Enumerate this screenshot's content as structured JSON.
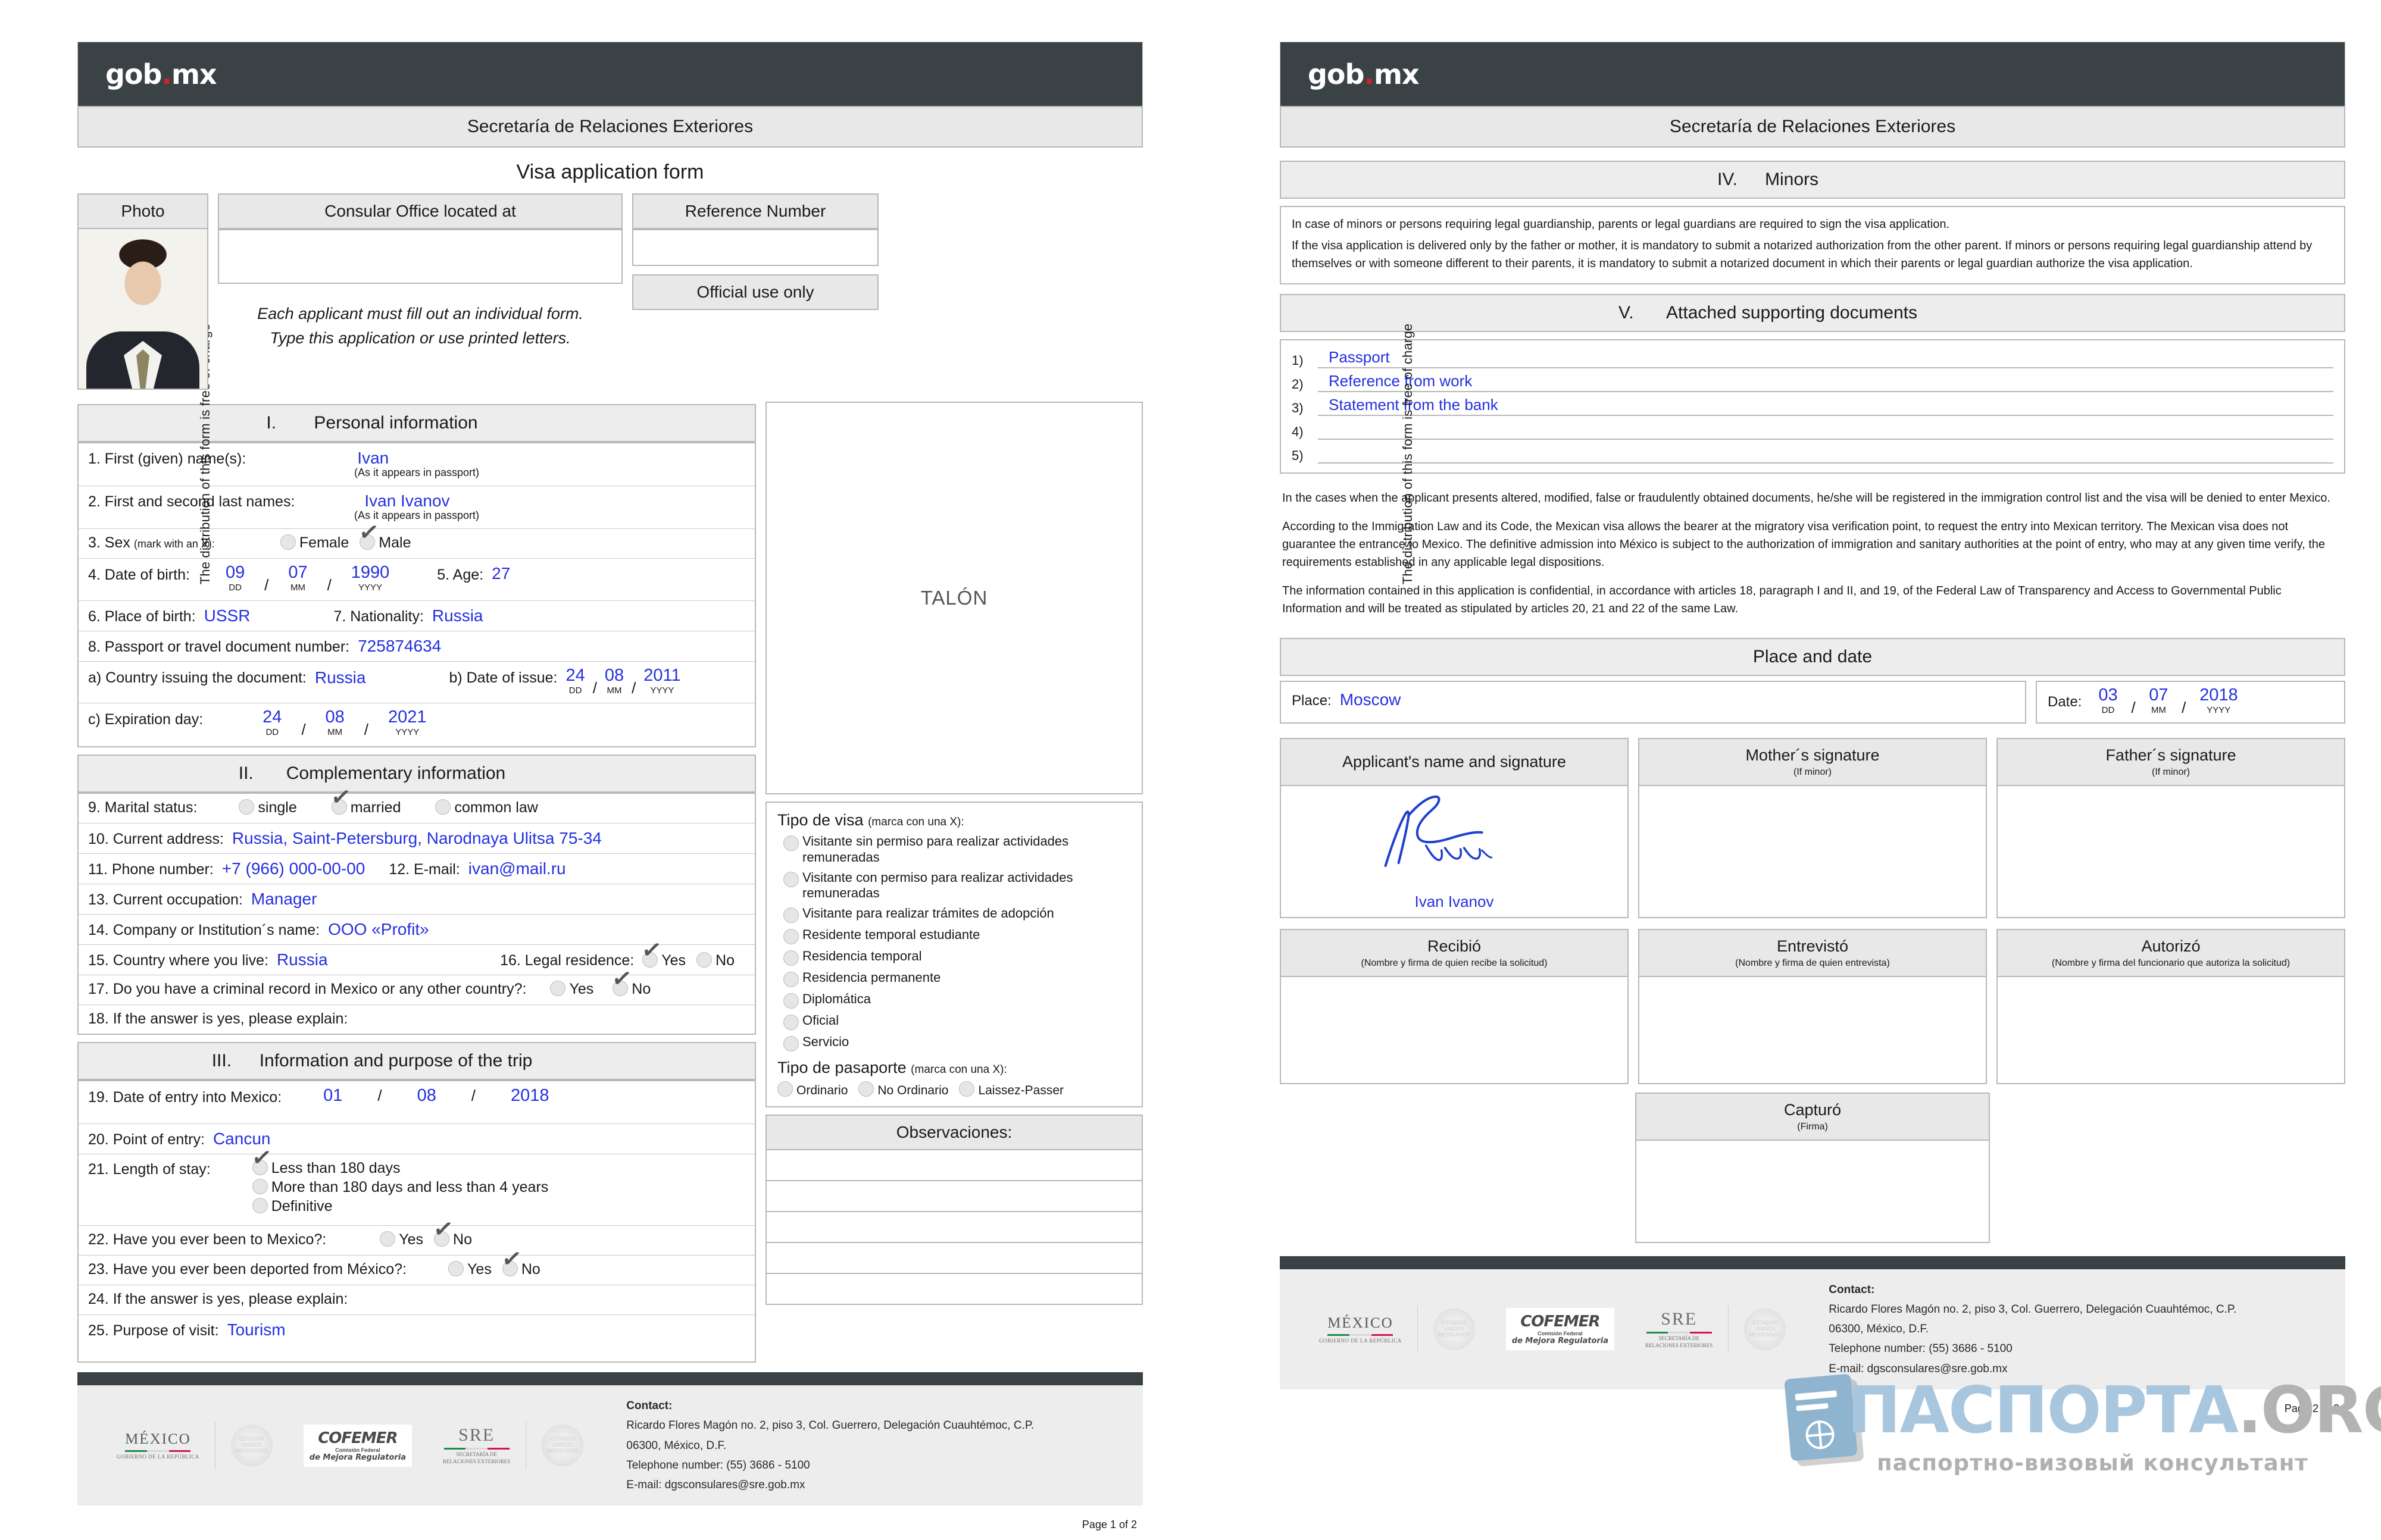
{
  "brand": {
    "logo_text": "gob",
    "logo_dot": ".",
    "logo_suffix": "mx",
    "accent_red": "#d62027",
    "value_blue": "#2430e0"
  },
  "side_note": "The distribution of this form is free of charge",
  "header": {
    "ministry": "Secretaría de Relaciones Exteriores",
    "form_title": "Visa application form"
  },
  "page1": {
    "photo_label": "Photo",
    "consular_office_label": "Consular Office located at",
    "consular_office_value": "",
    "instructions_line1": "Each applicant must fill out an individual form.",
    "instructions_line2": "Type this application or use printed letters.",
    "reference_number_label": "Reference Number",
    "reference_number_value": "",
    "official_use_label": "Official use only",
    "talon_label": "TALÓN",
    "section1": {
      "numeral": "I.",
      "title": "Personal information",
      "q1_label": "1. First (given) name(s):",
      "q1_value": "Ivan",
      "q1_hint": "(As it appears in passport)",
      "q2_label": "2. First and second last names:",
      "q2_value": "Ivan Ivanov",
      "q2_hint": "(As it appears in passport)",
      "q3_label": "3. Sex",
      "q3_hint": "(mark with an X):",
      "q3_options": [
        "Female",
        "Male"
      ],
      "q3_selected": "Male",
      "q4_label": "4. Date of birth:",
      "q4_dd": "09",
      "q4_mm": "07",
      "q4_yyyy": "1990",
      "q5_label": "5. Age:",
      "q5_value": "27",
      "q6_label": "6. Place of birth:",
      "q6_value": "USSR",
      "q7_label": "7. Nationality:",
      "q7_value": "Russia",
      "q8_label": "8. Passport or travel document number:",
      "q8_value": "725874634",
      "qa_label": "a) Country issuing the document:",
      "qa_value": "Russia",
      "qb_label": "b) Date of issue:",
      "qb_dd": "24",
      "qb_mm": "08",
      "qb_yyyy": "2011",
      "qc_label": "c) Expiration day:",
      "qc_dd": "24",
      "qc_mm": "08",
      "qc_yyyy": "2021",
      "unit_dd": "DD",
      "unit_mm": "MM",
      "unit_yyyy": "YYYY"
    },
    "section2": {
      "numeral": "II.",
      "title": "Complementary information",
      "q9_label": "9. Marital status:",
      "q9_options": [
        "single",
        "married",
        "common law"
      ],
      "q9_selected": "married",
      "q10_label": "10. Current address:",
      "q10_value": "Russia, Saint-Petersburg, Narodnaya Ulitsa 75-34",
      "q11_label": "11. Phone number:",
      "q11_value": "+7 (966) 000-00-00",
      "q12_label": "12. E-mail:",
      "q12_value": "ivan@mail.ru",
      "q13_label": "13. Current occupation:",
      "q13_value": "Manager",
      "q14_label": "14. Company or Institution´s name:",
      "q14_value": "OOO «Profit»",
      "q15_label": "15. Country where you live:",
      "q15_value": "Russia",
      "q16_label": "16. Legal residence:",
      "q16_options": [
        "Yes",
        "No"
      ],
      "q16_selected": "Yes",
      "q17_label": "17. Do you have a criminal record in Mexico or any other country?:",
      "q17_options": [
        "Yes",
        "No"
      ],
      "q17_selected": "No",
      "q18_label": "18. If the answer is yes, please explain:",
      "q18_value": ""
    },
    "section3": {
      "numeral": "III.",
      "title": "Information and purpose of the trip",
      "q19_label": "19. Date of entry into Mexico:",
      "q19_dd": "01",
      "q19_mm": "08",
      "q19_yyyy": "2018",
      "q20_label": "20. Point of entry:",
      "q20_value": "Cancun",
      "q21_label": "21. Length of stay:",
      "q21_options": [
        "Less than 180 days",
        "More than 180 days and less than 4 years",
        "Definitive"
      ],
      "q21_selected": "Less than 180 days",
      "q22_label": "22. Have you ever been to Mexico?:",
      "q22_options": [
        "Yes",
        "No"
      ],
      "q22_selected": "No",
      "q23_label": "23. Have you ever been deported from México?:",
      "q23_options": [
        "Yes",
        "No"
      ],
      "q23_selected": "No",
      "q24_label": "24. If the answer is yes, please explain:",
      "q24_value": "",
      "q25_label": "25. Purpose of visit:",
      "q25_value": "Tourism"
    },
    "visa_type": {
      "title": "Tipo de visa",
      "hint": "(marca con una X):",
      "options": [
        "Visitante sin permiso para realizar actividades remuneradas",
        "Visitante con permiso para realizar actividades remuneradas",
        "Visitante para realizar trámites de adopción",
        "Residente temporal estudiante",
        "Residencia temporal",
        "Residencia permanente",
        "Diplomática",
        "Oficial",
        "Servicio"
      ],
      "selected": ""
    },
    "passport_type": {
      "title": "Tipo de pasaporte",
      "hint": "(marca con una X):",
      "options": [
        "Ordinario",
        "No Ordinario",
        "Laissez-Passer"
      ],
      "selected": ""
    },
    "observaciones_label": "Observaciones:",
    "page_number": "Page 1 of 2"
  },
  "page2": {
    "section4": {
      "numeral": "IV.",
      "title": "Minors",
      "p1": "In case of minors or persons requiring legal guardianship, parents or legal guardians are required to sign the visa application.",
      "p2": "If the visa application is delivered only by the father or mother, it is mandatory to submit a notarized authorization from the other parent. If minors or persons requiring legal guardianship attend by themselves or with someone different to their parents, it is mandatory to submit a notarized document in which their parents or legal guardian authorize the visa application."
    },
    "section5": {
      "numeral": "V.",
      "title": "Attached supporting documents",
      "items": [
        {
          "n": "1)",
          "value": "Passport"
        },
        {
          "n": "2)",
          "value": "Reference from work"
        },
        {
          "n": "3)",
          "value": "Statement from the bank"
        },
        {
          "n": "4)",
          "value": ""
        },
        {
          "n": "5)",
          "value": ""
        }
      ]
    },
    "legal": {
      "p1": "In the cases when the applicant presents altered, modified, false or fraudulently obtained documents, he/she will be registered in the immigration control list and the visa will be denied to enter Mexico.",
      "p2": "According to the Immigration Law and its Code, the Mexican visa allows the bearer at the migratory visa verification point, to request the entry into Mexican territory. The Mexican visa does not guarantee the entrance to Mexico. The definitive admission into México is subject to the authorization of immigration and sanitary authorities at the point of entry, who may at any given time verify, the requirements established in any applicable legal dispositions.",
      "p3": "The information contained in this application is confidential, in accordance with articles 18, paragraph I and II, and 19, of the Federal Law of Transparency and Access to Governmental Public Information and will be treated as stipulated by articles 20, 21 and 22 of the same Law."
    },
    "place_and_date": {
      "title": "Place and date",
      "place_label": "Place:",
      "place_value": "Moscow",
      "date_label": "Date:",
      "dd": "03",
      "mm": "07",
      "yyyy": "2018",
      "unit_dd": "DD",
      "unit_mm": "MM",
      "unit_yyyy": "YYYY"
    },
    "signatures": {
      "applicant_title": "Applicant's name and signature",
      "applicant_name": "Ivan Ivanov",
      "mother_title": "Mother´s signature",
      "mother_hint": "(If minor)",
      "father_title": "Father´s signature",
      "father_hint": "(If minor)"
    },
    "official": {
      "recibio_title": "Recibió",
      "recibio_hint": "(Nombre y firma de quien recibe la solicitud)",
      "entrevisto_title": "Entrevistó",
      "entrevisto_hint": "(Nombre y firma de quien entrevista)",
      "autorizo_title": "Autorizó",
      "autorizo_hint": "(Nombre y firma del funcionario que autoriza la solicitud)",
      "capturo_title": "Capturó",
      "capturo_hint": "(Firma)"
    },
    "page_number": "Page 2 of 2"
  },
  "footer": {
    "contact_heading": "Contact:",
    "address_line1": "Ricardo Flores Magón no. 2, piso 3, Col. Guerrero, Delegación Cuauhtémoc, C.P.",
    "address_line2": "06300, México, D.F.",
    "telephone": "Telephone number: (55) 3686 - 5100",
    "email": "E-mail: dgsconsulares@sre.gob.mx",
    "logo_mexico": "MÉXICO",
    "logo_mexico_sub": "GOBIERNO DE LA REPÚBLICA",
    "logo_cofemer_1": "COFEMER",
    "logo_cofemer_2": "Comisión Federal",
    "logo_cofemer_3": "de Mejora Regulatoria",
    "logo_sre": "SRE",
    "logo_sre_sub1": "SECRETARÍA DE",
    "logo_sre_sub2": "RELACIONES EXTERIORES",
    "seal_text": "ESTADOS UNIDOS MEXICANOS"
  },
  "watermark": {
    "part_a": "ПАСПОРТА",
    "part_b": ".ORG",
    "subtitle": "паспортно-визовый консультант"
  }
}
